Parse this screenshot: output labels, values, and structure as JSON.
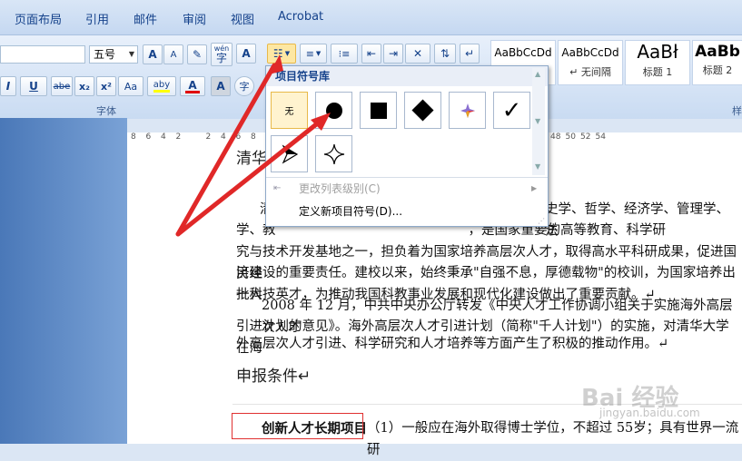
{
  "tabs": [
    "页面布局",
    "引用",
    "邮件",
    "审阅",
    "视图",
    "Acrobat"
  ],
  "font": {
    "size": "五号",
    "group_label": "字体"
  },
  "font_buttons": {
    "highlight_label": "aby",
    "color_label": "A",
    "case_label": "Aa",
    "strike_label": "abe",
    "sub_label": "x₂",
    "sup_label": "x²",
    "underline_label": "U",
    "italic_label": "I",
    "wen_label": "wén",
    "wen_sub": "字",
    "grow_label": "A",
    "shrink_label": "A",
    "border_label": "A",
    "char_label": "字"
  },
  "styles": [
    {
      "preview": "AaBbCcDd",
      "name": ""
    },
    {
      "preview": "AaBbCcDd",
      "name": "↵ 无间隔"
    },
    {
      "preview": "AaBł",
      "name": "标题 1"
    },
    {
      "preview": "AaBb",
      "name": "标题 2"
    }
  ],
  "ruler_ticks": [
    "8",
    "6",
    "4",
    "2",
    "",
    "2",
    "4",
    "6",
    "8",
    "10",
    "12",
    "14",
    "16",
    "18",
    "20",
    "22",
    "24",
    "26",
    "28",
    "30",
    "32",
    "34",
    "36",
    "38",
    "40",
    "42",
    "44",
    "46",
    "48",
    "50",
    "52",
    "54"
  ],
  "popup": {
    "title": "项目符号库",
    "none_label": "无",
    "change_level": "更改列表级别(C)",
    "define_new": "定义新项目符号(D)..."
  },
  "document": {
    "title_fragment": "清华",
    "p1_l0": "清",
    "p1_l0_right": "史学、哲学、经济学、管理学、法",
    "p1_l1": "学、教                                              ，是国家重要的高等教育、科学研",
    "p1_l2": "究与技术开发基地之一，担负着为国家培养高层次人才，取得高水平科研成果，促进国民经",
    "p1_l3": "济建设的重要责任。建校以来，始终秉承\"自强不息，厚德载物\"的校训，为国家培养出一大",
    "p1_l4": "批科技英才，为推动我国科教事业发展和现代化建设做出了重要贡献。↵",
    "p2_l1": "2008 年 12 月，中共中央办公厅转发《中央人才工作协调小组关于实施海外高层次人才",
    "p2_l2": "引进计划的意见》。海外高层次人才引进计划（简称\"千人计划\"）的实施，对清华大学在海",
    "p2_l3": "外高层次人才引进、科学研究和人才培养等方面产生了积极的推动作用。↵",
    "heading": "申报条件↵",
    "bold_label": "创新人才长期项目",
    "p3_rest": "（1）一般应在海外取得博士学位，不超过 55岁；具有世界一流研"
  },
  "watermark": {
    "main": "Bai 经验",
    "sub": "jingyan.baidu.com"
  },
  "colors": {
    "annotation": "#e03030",
    "highlight": "#ffff00",
    "font_color": "#e00000"
  }
}
